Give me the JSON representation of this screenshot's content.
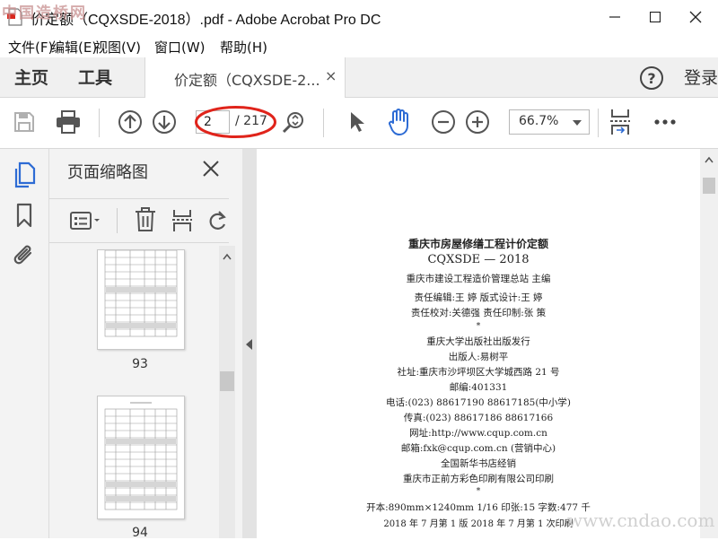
{
  "window": {
    "title": "价定额（CQXSDE-2018）.pdf - Adobe Acrobat Pro DC",
    "watermark_tl": "中国造桥网",
    "watermark_br": "www.cndao.com"
  },
  "menu": [
    "文件(F)",
    "编辑(E)",
    "视图(V)",
    "窗口(W)",
    "帮助(H)"
  ],
  "nav": {
    "home": "主页",
    "tools": "工具",
    "doc_tab": "价定额（CQXSDE-2...",
    "close_glyph": "×",
    "login": "登录"
  },
  "toolbar": {
    "current_page": "2",
    "total_pages": "/ 217",
    "zoom": "66.7%"
  },
  "thumbnails": {
    "title": "页面缩略图",
    "pages": [
      "93",
      "94"
    ]
  },
  "document": {
    "lines": [
      "重庆市房屋修缮工程计价定额",
      "CQXSDE — 2018",
      "重庆市建设工程造价管理总站  主编",
      "责任编辑:王  婷       版式设计:王  婷",
      "责任校对:关德强      责任印制:张  策",
      "*",
      "重庆大学出版社出版发行",
      "出版人:易树平",
      "社址:重庆市沙坪坝区大学城西路 21 号",
      "邮编:401331",
      "电话:(023) 88617190   88617185(中小学)",
      "传真:(023) 88617186   88617166",
      "网址:http://www.cqup.com.cn",
      "邮箱:fxk@cqup.com.cn (营销中心)",
      "全国新华书店经销",
      "重庆市正前方彩色印刷有限公司印刷",
      "*",
      "开本:890mm×1240mm  1/16  印张:15  字数:477 千",
      "2018 年 7 月第 1 版    2018 年 7 月第 1 次印刷"
    ]
  },
  "colors": {
    "accent": "#2d6bd4",
    "annotation": "#e0241b"
  }
}
